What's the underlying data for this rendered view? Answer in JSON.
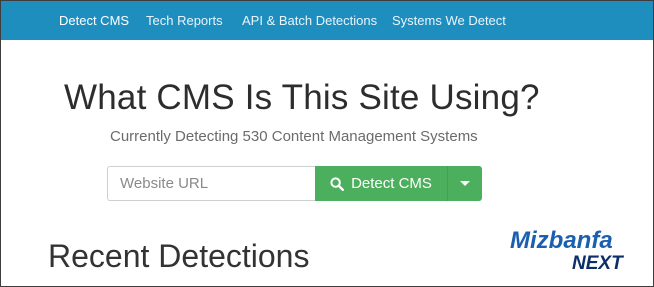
{
  "nav": {
    "items": [
      {
        "label": "Detect CMS",
        "active": true
      },
      {
        "label": "Tech Reports"
      },
      {
        "label": "API & Batch Detections"
      },
      {
        "label": "Systems We Detect"
      }
    ],
    "background": "#1e8ebf"
  },
  "hero": {
    "title": "What CMS Is This Site Using?",
    "subtitle": "Currently Detecting 530 Content Management Systems"
  },
  "search": {
    "placeholder": "Website URL",
    "value": "",
    "button_label": "Detect CMS",
    "button_icon": "search-icon",
    "dropdown_icon": "caret-down-icon",
    "button_color": "#4caf5d"
  },
  "recent": {
    "heading": "Recent Detections"
  },
  "watermark": {
    "line1": "Mizbanfa",
    "line2": "NEXT",
    "colors": {
      "primary": "#1b5fb0",
      "secondary": "#0b2f66"
    }
  }
}
